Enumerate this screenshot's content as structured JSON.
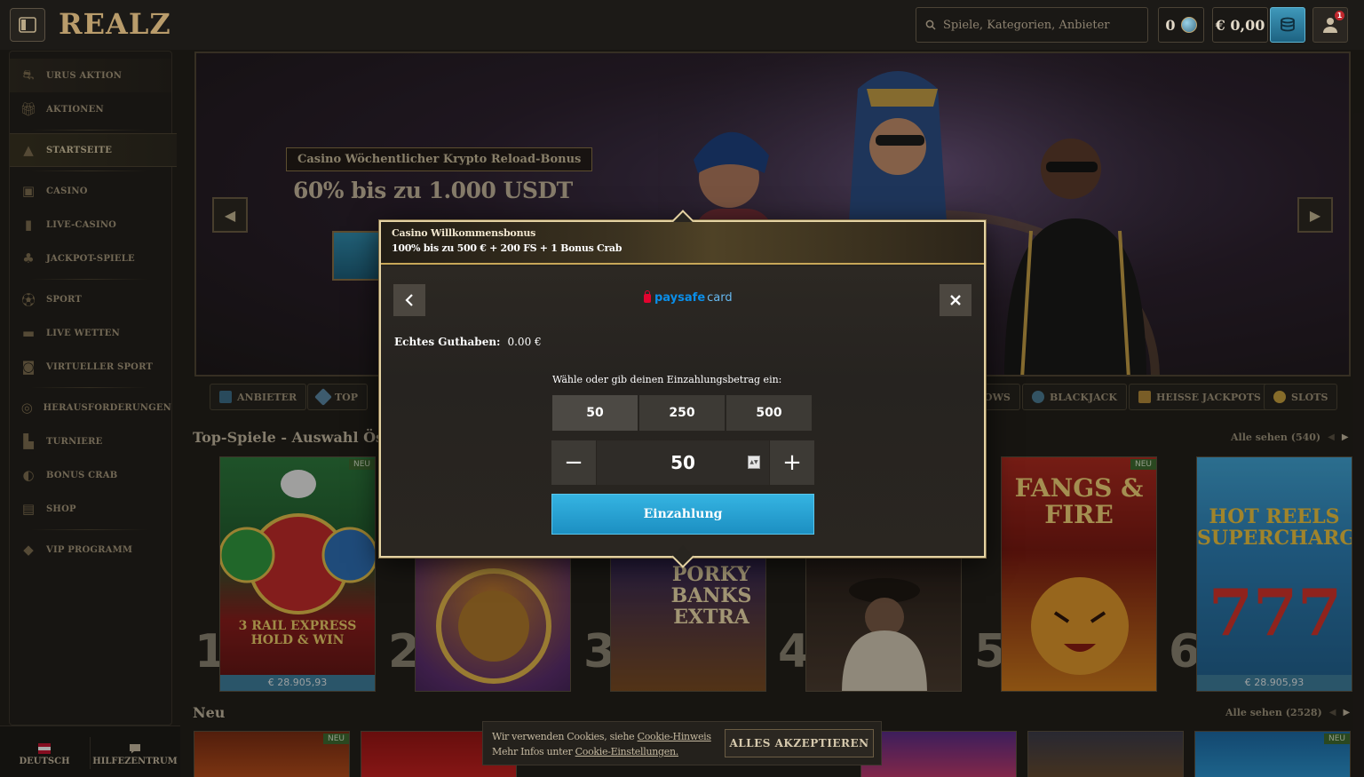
{
  "header": {
    "logo": "REALZ",
    "search_placeholder": "Spiele, Kategorien, Anbieter",
    "coins": "0",
    "balance": "€ 0,00",
    "notification_count": "1"
  },
  "sidebar": {
    "items": [
      {
        "label": "URUS AKTION",
        "icon": "car-icon"
      },
      {
        "label": "AKTIONEN",
        "icon": "gift-icon"
      },
      {
        "label": "STARTSEITE",
        "icon": "pyramid-icon"
      },
      {
        "label": "CASINO",
        "icon": "casino-icon"
      },
      {
        "label": "LIVE-CASINO",
        "icon": "live-casino-icon"
      },
      {
        "label": "JACKPOT-SPIELE",
        "icon": "jackpot-icon"
      },
      {
        "label": "SPORT",
        "icon": "ball-icon"
      },
      {
        "label": "LIVE WETTEN",
        "icon": "live-icon"
      },
      {
        "label": "VIRTUELLER SPORT",
        "icon": "virtual-icon"
      },
      {
        "label": "HERAUSFORDERUNGEN",
        "icon": "challenge-icon"
      },
      {
        "label": "TURNIERE",
        "icon": "tournament-icon"
      },
      {
        "label": "BONUS CRAB",
        "icon": "crab-icon"
      },
      {
        "label": "SHOP",
        "icon": "shop-icon"
      },
      {
        "label": "VIP PROGRAMM",
        "icon": "diamond-icon"
      }
    ],
    "language": "DEUTSCH",
    "help": "HILFEZENTRUM"
  },
  "banner": {
    "tag": "Casino Wöchentlicher Krypto Reload-Bonus",
    "title": "60% bis zu 1.000 USDT"
  },
  "categories": [
    {
      "label": "ANBIETER"
    },
    {
      "label": "TOP"
    },
    {
      "label": "OWS"
    },
    {
      "label": "BLACKJACK"
    },
    {
      "label": "HEISSE JACKPOTS"
    },
    {
      "label": "SLOTS"
    }
  ],
  "sections": {
    "top_title": "Top-Spiele - Auswahl Österrei",
    "top_see_all": "Alle sehen (540)",
    "new_title": "Neu",
    "new_see_all": "Alle sehen (2528)"
  },
  "games": [
    {
      "rank": "1",
      "title": "3 RAIL EXPRESS HOLD & WIN",
      "jackpot": "€ 28.905,93",
      "badge": "NEU"
    },
    {
      "rank": "2",
      "title": "",
      "jackpot": "",
      "badge": ""
    },
    {
      "rank": "3",
      "title": "PORKY BANKS EXTRA",
      "jackpot": "",
      "badge": ""
    },
    {
      "rank": "4",
      "title": "",
      "jackpot": "",
      "badge": ""
    },
    {
      "rank": "5",
      "title": "FANGS & FIRE",
      "jackpot": "",
      "badge": "NEU"
    },
    {
      "rank": "6",
      "title": "HOT REELS SUPERCHARGED",
      "jackpot": "€ 28.905,93",
      "badge": ""
    }
  ],
  "new_badges": {
    "first": "NEU",
    "last": "NEU"
  },
  "modal": {
    "header_title": "Casino Willkommensbonus",
    "header_subtitle": "100% bis zu 500 € + 200 FS + 1 Bonus Crab",
    "provider_a": "paysafe",
    "provider_b": "card",
    "balance_label": "Echtes Guthaben:",
    "balance_value": "0.00 €",
    "prompt": "Wähle oder gib deinen Einzahlungsbetrag ein:",
    "amounts": [
      "50",
      "250",
      "500"
    ],
    "selected_amount": "50",
    "input_value": "50",
    "deposit_label": "Einzahlung"
  },
  "cookie": {
    "line1_prefix": "Wir verwenden Cookies, siehe ",
    "line1_link": "Cookie-Hinweis",
    "line2_prefix": "Mehr Infos unter ",
    "line2_link": "Cookie-Einstellungen.",
    "accept": "ALLES AKZEPTIEREN"
  },
  "colors": {
    "accent_blue": "#1c8fc2",
    "gold_border": "#e4d2a2",
    "background": "#1f1c18"
  }
}
